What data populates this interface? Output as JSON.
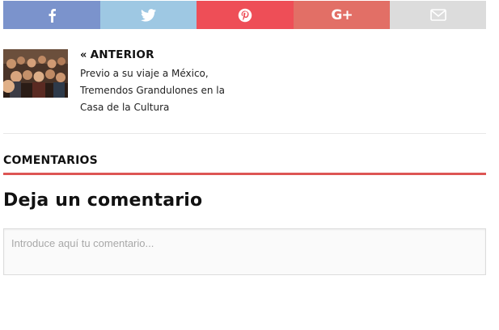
{
  "share_bar": {
    "buttons": [
      {
        "network": "facebook",
        "icon": "facebook-icon",
        "color": "#7b93cc"
      },
      {
        "network": "twitter",
        "icon": "twitter-icon",
        "color": "#9ec8e3"
      },
      {
        "network": "pinterest",
        "icon": "pinterest-icon",
        "color": "#ee4e57"
      },
      {
        "network": "google-plus",
        "icon": "google-plus-icon",
        "label": "G+",
        "color": "#e26f66"
      },
      {
        "network": "email",
        "icon": "envelope-icon",
        "color": "#dcdcdc"
      }
    ]
  },
  "previous_post": {
    "label": "ANTERIOR",
    "chevron": "«",
    "title": "Previo a su viaje a México, Tremendos Grandulones en la Casa de la Cultura"
  },
  "comments": {
    "heading": "COMENTARIOS",
    "accent_color": "#dd5554"
  },
  "reply": {
    "title": "Deja un comentario",
    "placeholder": "Introduce aquí tu comentario..."
  }
}
